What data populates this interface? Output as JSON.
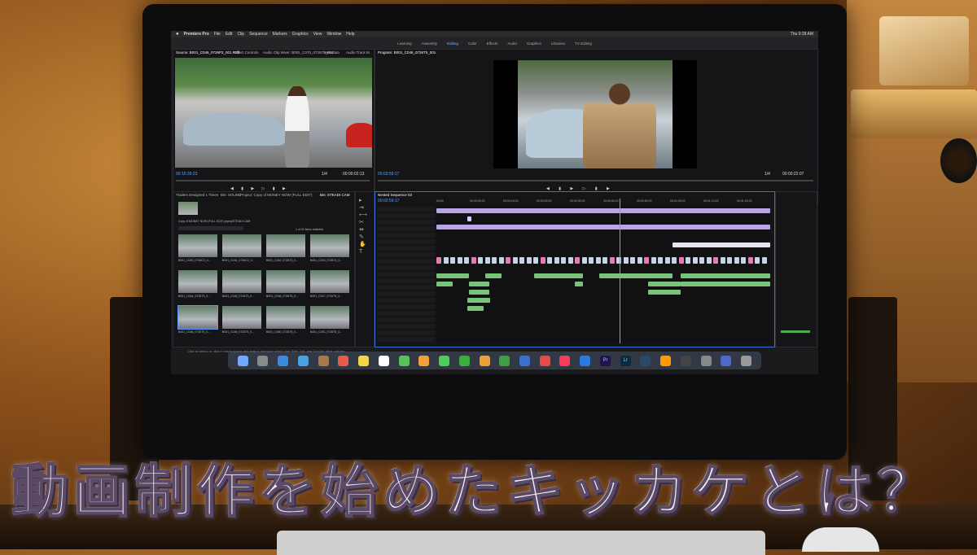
{
  "menubar": {
    "app": "Premiere Pro",
    "items": [
      "File",
      "Edit",
      "Clip",
      "Sequence",
      "Markers",
      "Graphics",
      "View",
      "Window",
      "Help"
    ],
    "clock": "Thu 9:28 AM"
  },
  "workspaces": {
    "tabs": [
      "Learning",
      "Assembly",
      "Editing",
      "Color",
      "Effects",
      "Audio",
      "Graphics",
      "Libraries",
      "TV Editing"
    ],
    "active": "Editing"
  },
  "source_panel": {
    "tabs": [
      "Source: B001_C046_0726P2_001.R3D",
      "Effect Controls",
      "Audio Clip Mixer: B001_C070_0726T5_001",
      "Metadata",
      "Audio Track M"
    ],
    "timecode_in": "00:16:39:23",
    "timecode_out": "00:00:02:13",
    "zoom": "1/4"
  },
  "program_panel": {
    "title": "Program: B001_C046_0726T5_001",
    "timecode_in": "00:02:59:17",
    "timecode_out": "00:00:22:07",
    "zoom": "1/4"
  },
  "project_panel": {
    "tabs": [
      "Trailers Designed 1 Times",
      "Bin: SOUND",
      "Project: Copy of MONEY NOW (FULL EDIT)",
      "Bin: STEADI CAM"
    ],
    "active_tab": "Bin: STEADI CAM",
    "breadcrumb": "Copy of MONEY NOW (FULL EDIT).prproj\\STEADI CAM",
    "selection": "1 of 41 items selected",
    "thumbs": [
      {
        "label": "B001_C040_0726C2_0..."
      },
      {
        "label": "B001_C041_0726C2_0..."
      },
      {
        "label": "B001_C042_0726T3_0..."
      },
      {
        "label": "B001_C043_0726T3_0..."
      },
      {
        "label": "B001_C044_0726T3_0..."
      },
      {
        "label": "B001_C045_0726T3_0..."
      },
      {
        "label": "B001_C046_0726T5_0..."
      },
      {
        "label": "B001_C047_0726T5_0..."
      },
      {
        "label": "B001_C048_0726T5_0..."
      },
      {
        "label": "B001_C049_0726T5_0..."
      },
      {
        "label": "B001_C050_0726T5_0..."
      },
      {
        "label": "B001_C051_0726T5_0..."
      }
    ]
  },
  "timeline": {
    "tab": "Nested Sequence 03",
    "timecode": "00:02:59:17",
    "ruler": [
      "00:00",
      "00:00:09:23",
      "00:00:19:23",
      "00:00:29:23",
      "00:00:39:23",
      "00:00:49:23",
      "00:00:59:23",
      "00:01:09:23",
      "00:01:19:23",
      "00:01:29:23"
    ]
  },
  "status": "Click to select, or click in empty space and drag to marquee select. Use Shift, Opt, and Cmd for other options.",
  "dock": {
    "icons": [
      "finder-icon",
      "launchpad-icon",
      "safari-icon",
      "mail-icon",
      "contacts-icon",
      "calendar-icon",
      "notes-icon",
      "reminders-icon",
      "maps-icon",
      "photos-icon",
      "messages-icon",
      "facetime-icon",
      "pages-icon",
      "numbers-icon",
      "keynote-icon",
      "news-icon",
      "music-icon",
      "appstore-icon",
      "premiere-icon",
      "lightroom-icon",
      "media-encoder-icon",
      "illustrator-icon",
      "quicktime-icon",
      "screenshot-icon",
      "downloads-icon",
      "trash-icon"
    ],
    "pr_label": "Pr",
    "lr_label": "Lr"
  },
  "headline": "動画制作を始めたキッカケとは？",
  "colors": {
    "accent_blue": "#5fa0ff",
    "clip_purple": "#b9a4e6",
    "clip_green": "#79c37b",
    "headline_fill": "#f4eef6"
  }
}
